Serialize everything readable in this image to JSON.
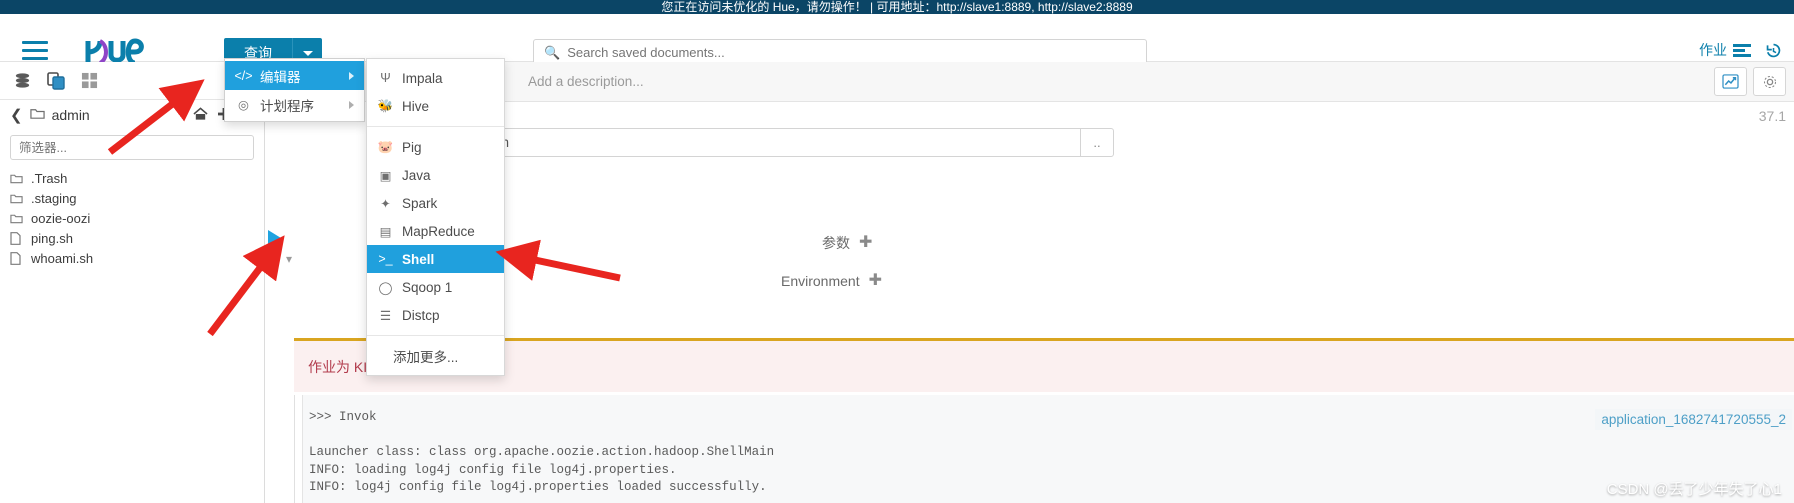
{
  "banner": {
    "text": "您正在访问未优化的 Hue，请勿操作！ | 可用地址：http://slave1:8889, http://slave2:8889"
  },
  "navbar": {
    "brand": "Hue",
    "query_button": "查询",
    "search_placeholder": "Search saved documents...",
    "right_items": [
      {
        "label": "作业",
        "icon": "jobs-icon"
      },
      {
        "label": "",
        "icon": "history-icon"
      }
    ]
  },
  "sidebar": {
    "tabs": [
      {
        "name": "database-icon"
      },
      {
        "name": "documents-icon"
      },
      {
        "name": "apps-grid-icon"
      }
    ],
    "breadcrumb": "admin",
    "filter_placeholder": "筛选器...",
    "files": [
      {
        "name": ".Trash",
        "type": "folder"
      },
      {
        "name": ".staging",
        "type": "folder"
      },
      {
        "name": "oozie-oozi",
        "type": "folder"
      },
      {
        "name": "ping.sh",
        "type": "file"
      },
      {
        "name": "whoami.sh",
        "type": "file"
      }
    ]
  },
  "main": {
    "description_placeholder": "Add a description...",
    "version_label": "37.1",
    "script_path": "admin/whoami.sh",
    "browse_label": "..",
    "params_label": "参数",
    "environment_label": "Environment",
    "warning_text": "作业为 KI",
    "application_link": "application_1682741720555_2",
    "console_lines": [
      ">>> Invok",
      "",
      "Launcher class: class org.apache.oozie.action.hadoop.ShellMain",
      "INFO: loading log4j config file log4j.properties.",
      "INFO: log4j config file log4j.properties loaded successfully."
    ]
  },
  "menu_primary": {
    "items": [
      {
        "label": "编辑器",
        "icon": "code-icon",
        "active": true,
        "has_submenu": true
      },
      {
        "label": "计划程序",
        "icon": "scheduler-icon",
        "active": false,
        "has_submenu": true
      }
    ]
  },
  "menu_secondary": {
    "group1": [
      {
        "label": "Impala",
        "icon": "impala-icon"
      },
      {
        "label": "Hive",
        "icon": "hive-icon"
      }
    ],
    "group2": [
      {
        "label": "Pig",
        "icon": "pig-icon",
        "active": false
      },
      {
        "label": "Java",
        "icon": "java-icon",
        "active": false
      },
      {
        "label": "Spark",
        "icon": "spark-icon",
        "active": false
      },
      {
        "label": "MapReduce",
        "icon": "mapreduce-icon",
        "active": false
      },
      {
        "label": "Shell",
        "icon": "shell-icon",
        "active": true
      },
      {
        "label": "Sqoop 1",
        "icon": "sqoop-icon",
        "active": false
      },
      {
        "label": "Distcp",
        "icon": "distcp-icon",
        "active": false
      }
    ],
    "group3": [
      {
        "label": "添加更多...",
        "icon": "",
        "active": false
      }
    ]
  },
  "watermark": "CSDN @丢了少年失了心1",
  "colors": {
    "accent": "#0b7fab",
    "highlight": "#20a0dd",
    "banner_bg": "#0b4566",
    "warning_border": "#d9a520",
    "warning_bg": "#fbf0f0",
    "arrow": "#e8251f"
  }
}
